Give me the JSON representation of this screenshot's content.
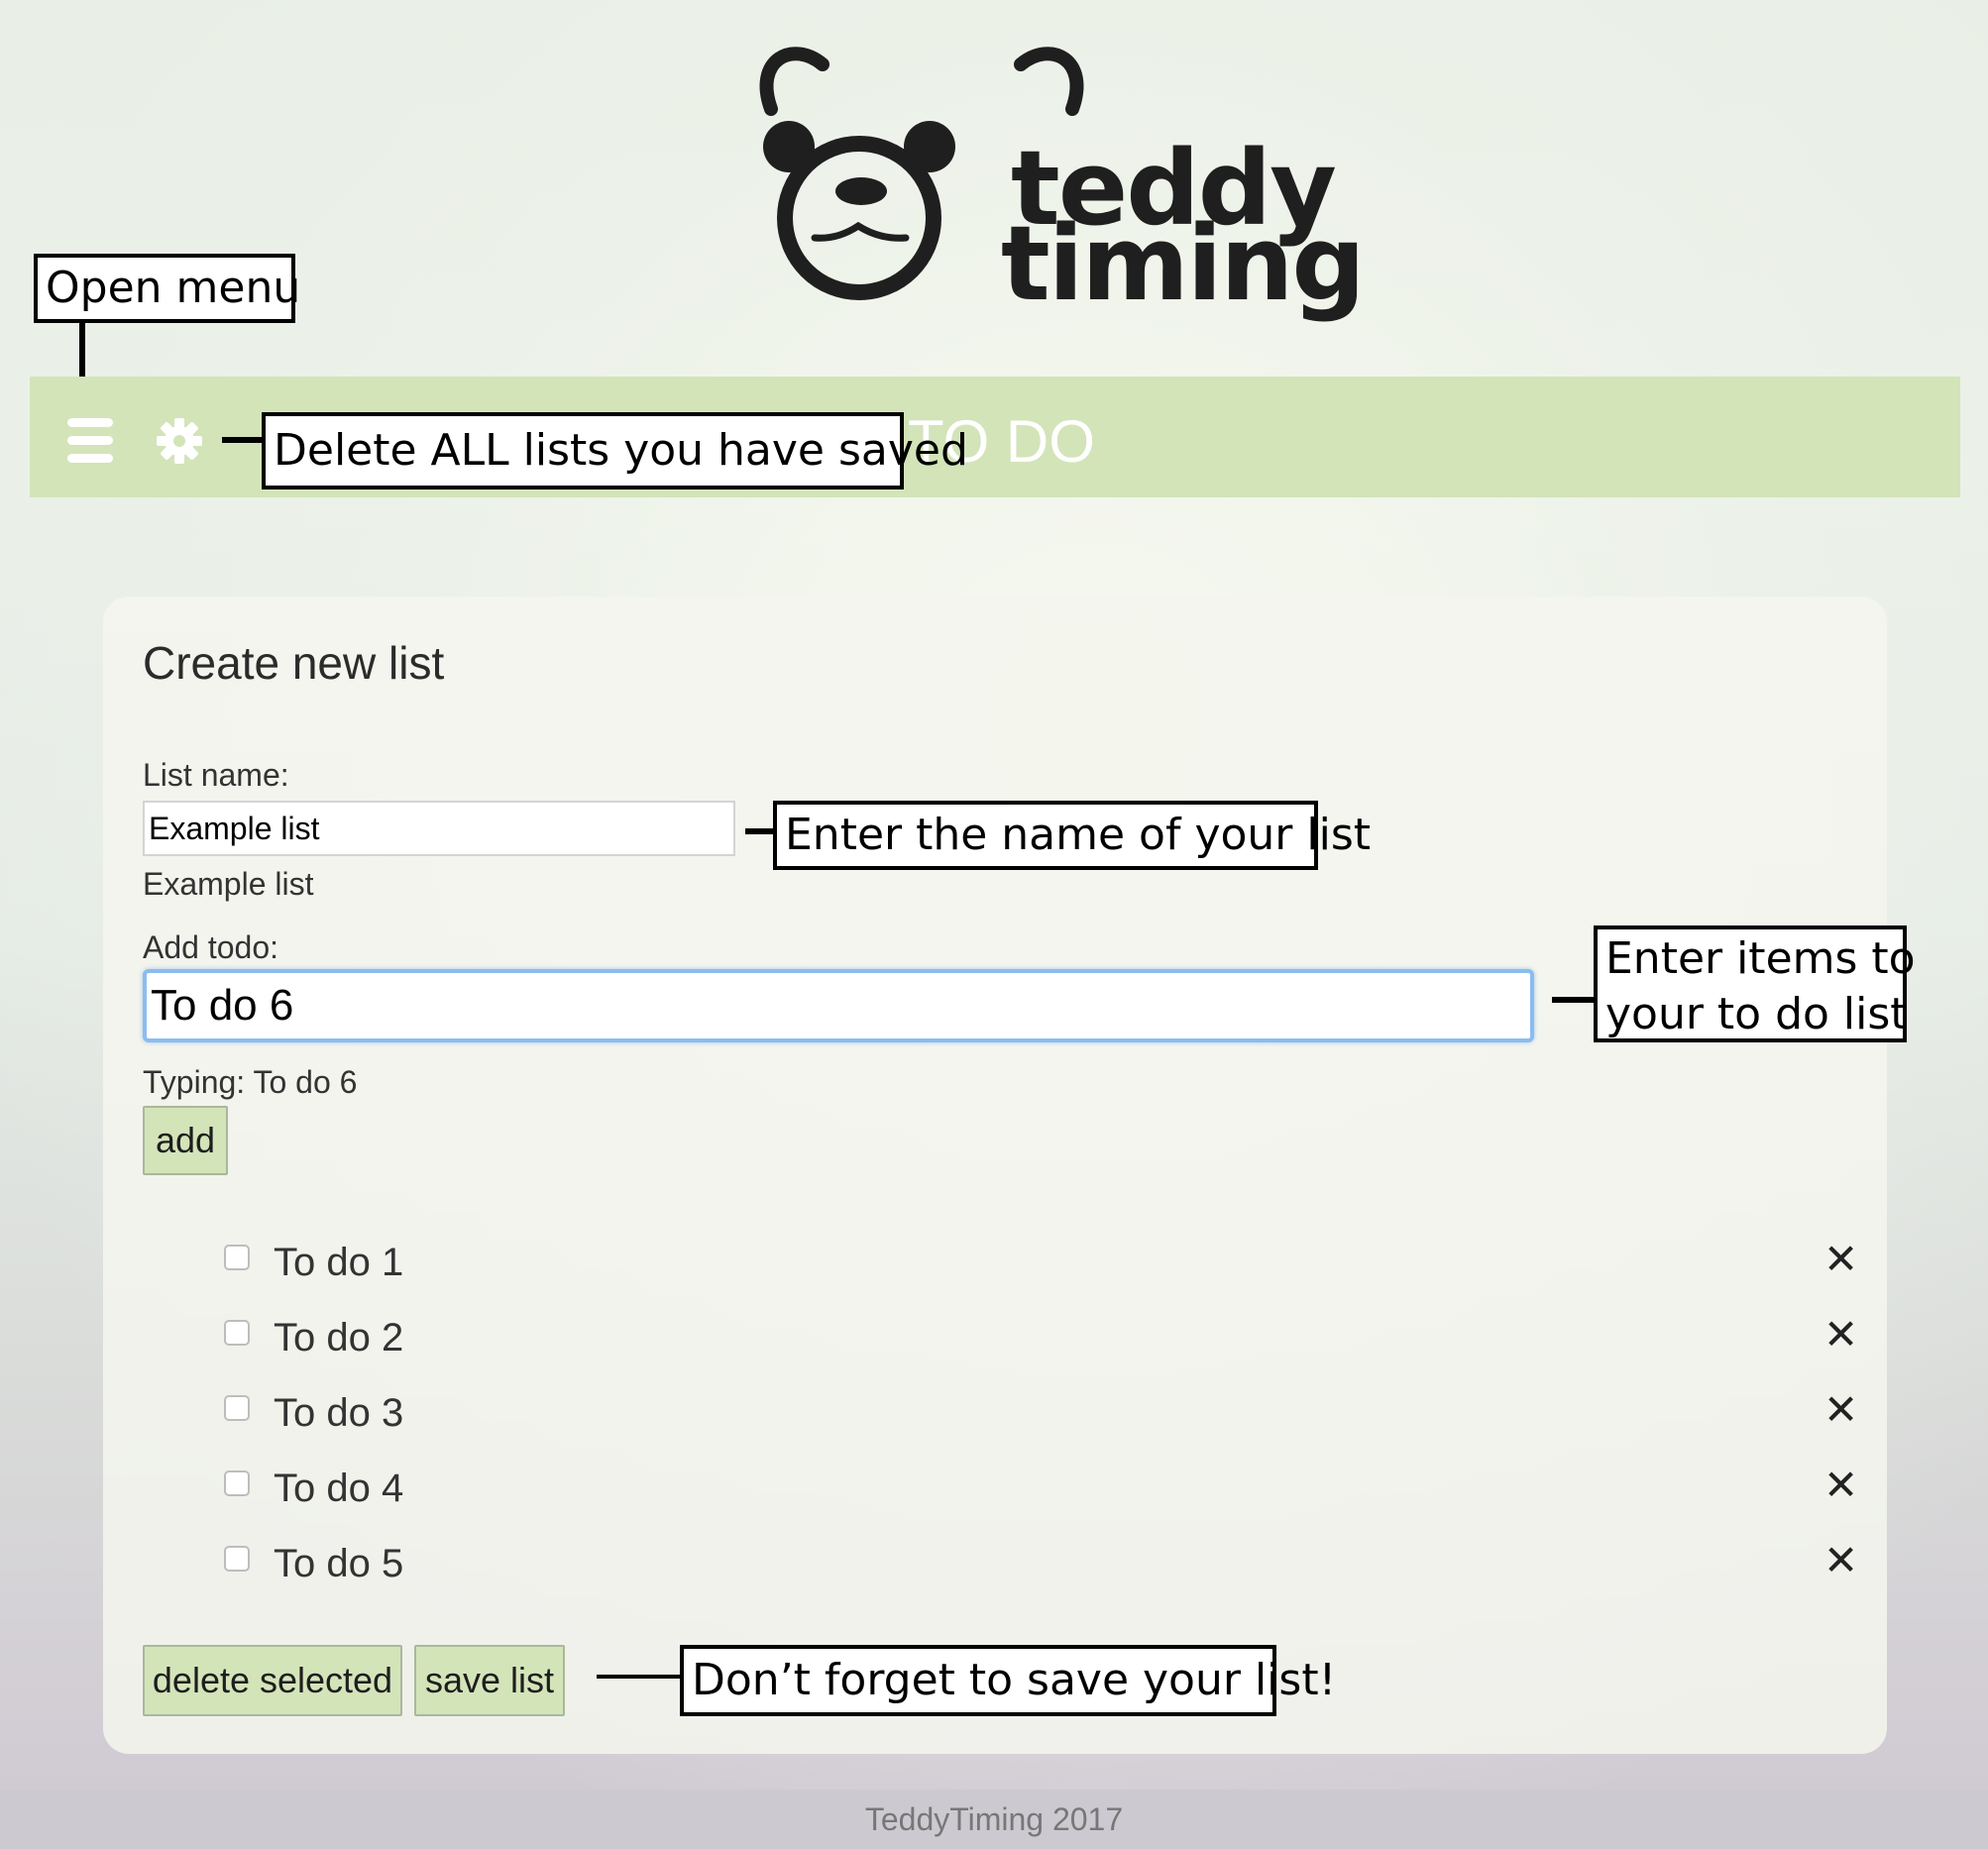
{
  "brand": {
    "line1": "teddy",
    "line2": "timing"
  },
  "header": {
    "title": "TO DO",
    "menu_icon": "hamburger-icon",
    "settings_icon": "gear-icon"
  },
  "annotations": {
    "open_menu": "Open menu",
    "delete_all": "Delete ALL lists you have saved",
    "list_name": "Enter the name of your list",
    "items": [
      "Enter items to",
      "your to do list"
    ],
    "save": "Don’t forget to save your list!"
  },
  "card": {
    "title": "Create new list",
    "list_name_label": "List name:",
    "list_name_value": "Example list",
    "list_name_echo": "Example list",
    "add_todo_label": "Add todo:",
    "add_todo_value": "To do 6",
    "typing_text": "Typing: To do 6",
    "add_button": "add",
    "todos": [
      {
        "label": "To do 1",
        "checked": false
      },
      {
        "label": "To do 2",
        "checked": false
      },
      {
        "label": "To do 3",
        "checked": false
      },
      {
        "label": "To do 4",
        "checked": false
      },
      {
        "label": "To do 5",
        "checked": false
      }
    ],
    "remove_glyph": "✕",
    "delete_selected_button": "delete selected",
    "save_list_button": "save list"
  },
  "footer": {
    "text": "TeddyTiming 2017"
  },
  "colors": {
    "header_bar": "#d3e4b9",
    "button": "#d3e4b9",
    "focus_ring": "#8bbcf0"
  }
}
